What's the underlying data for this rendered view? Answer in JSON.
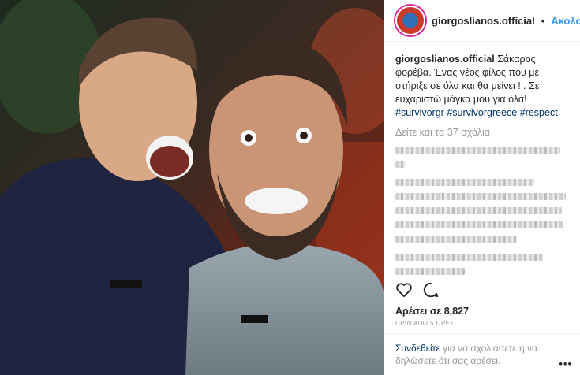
{
  "header": {
    "username": "giorgoslianos.official",
    "separator": "•",
    "follow_label": "Ακολουθήστε"
  },
  "caption": {
    "username": "giorgoslianos.official",
    "text": "Σάκαρος φορέβα. Ένας νέος φίλος που με στήριξε σε όλα και θα μείνει ! . Σε ευχαριστώ μάγκα μου για όλα!",
    "hashtags": [
      "#survivorgr",
      "#survivorgreece",
      "#respect"
    ]
  },
  "view_all_comments": "Δείτε και τα 37 σχόλια",
  "likes": "Αρέσει σε 8,827",
  "timestamp": "ΠΡΙΝ ΑΠΟ 5 ΩΡΕΣ",
  "login_prompt": {
    "link": "Συνδεθείτε",
    "text": "για να σχολιάσετε ή να δηλώσετε ότι σας αρέσει."
  },
  "more_options": "•••",
  "icons": [
    "heart-icon",
    "comment-icon"
  ]
}
